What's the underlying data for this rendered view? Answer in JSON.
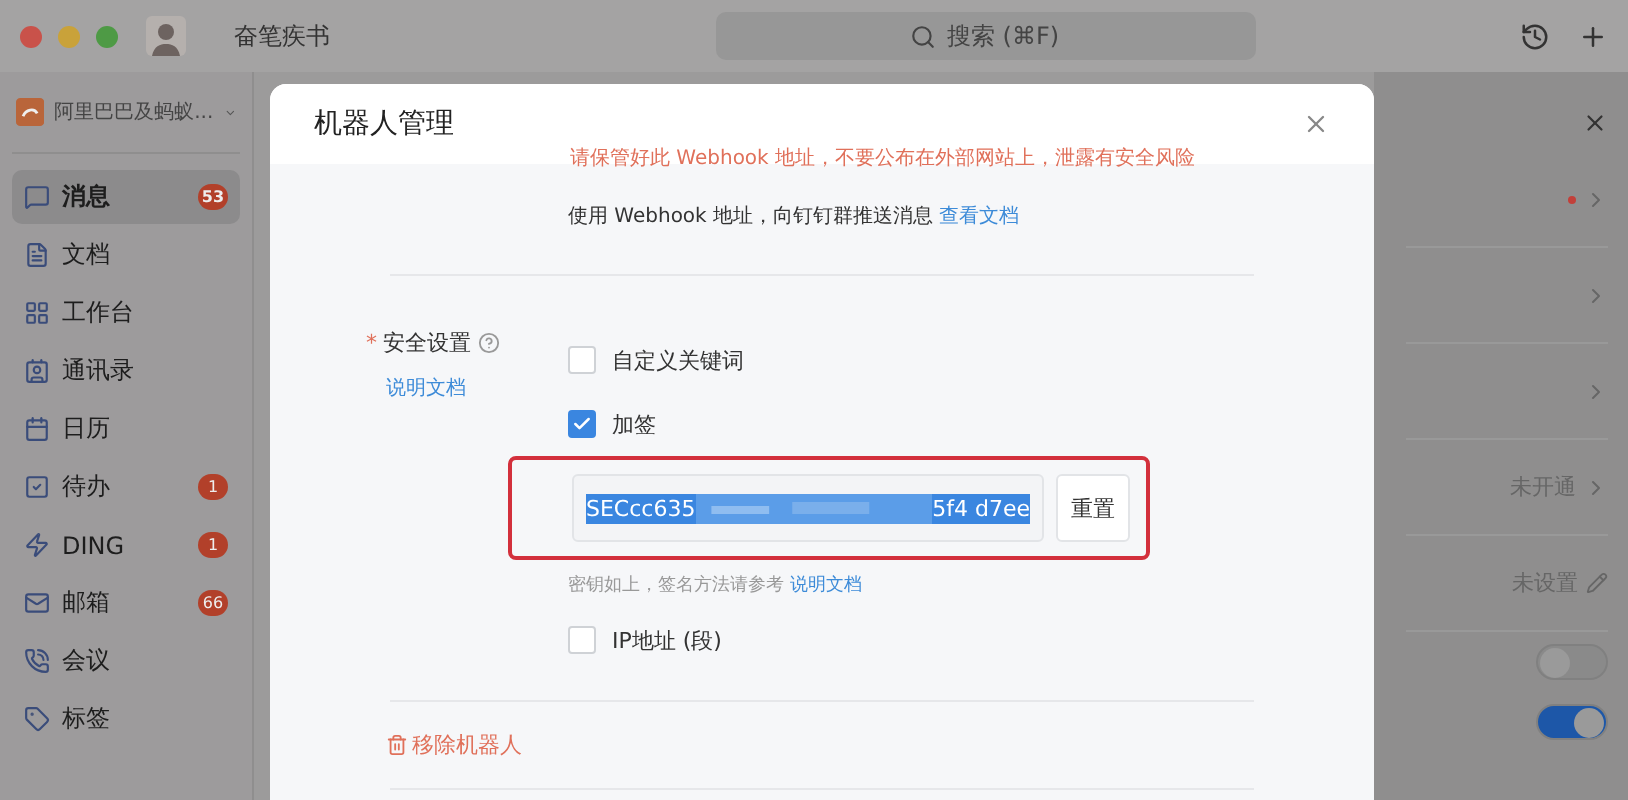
{
  "titlebar": {
    "user_name": "奋笔疾书",
    "search": {
      "placeholder": "搜索 (⌘F)"
    }
  },
  "sidebar": {
    "org": "阿里巴巴及蚂蚁...",
    "items": [
      {
        "label": "消息",
        "badge": "53",
        "selected": true
      },
      {
        "label": "文档",
        "selected": false
      },
      {
        "label": "工作台",
        "selected": false
      },
      {
        "label": "通讯录",
        "selected": false
      },
      {
        "label": "日历",
        "selected": false
      },
      {
        "label": "待办",
        "badge": "1",
        "selected": false
      },
      {
        "label": "DING",
        "badge": "1",
        "selected": false
      },
      {
        "label": "邮箱",
        "badge": "66",
        "selected": false
      },
      {
        "label": "会议",
        "selected": false
      },
      {
        "label": "标签",
        "selected": false
      }
    ]
  },
  "dialog": {
    "title": "机器人管理",
    "warning": "请保管好此 Webhook 地址，不要公布在外部网站上，泄露有安全风险",
    "webhook_note": "使用 Webhook 地址，向钉钉群推送消息",
    "webhook_link": "查看文档",
    "security": {
      "label": "安全设置",
      "required_mark": "*",
      "doc_link": "说明文档",
      "options": [
        {
          "kind": "checkbox",
          "label": "自定义关键词",
          "checked": false
        },
        {
          "kind": "checkbox",
          "label": "加签",
          "checked": true
        },
        {
          "kind": "secret",
          "value_start": "SECcc635",
          "value_end": "5f4 d7ee",
          "button": "重置",
          "highlighted": true
        },
        {
          "kind": "hint",
          "text": "密钥如上，签名方法请参考",
          "link": "说明文档"
        },
        {
          "kind": "checkbox",
          "label": "IP地址 (段)",
          "checked": false
        }
      ]
    },
    "remove": "移除机器人"
  },
  "right_panel": {
    "rows": [
      {
        "kind": "link",
        "dot": true
      },
      {
        "kind": "link",
        "dot": false
      },
      {
        "kind": "link",
        "dot": false
      },
      {
        "kind": "link",
        "value": "未开通"
      },
      {
        "kind": "edit",
        "value": "未设置"
      },
      {
        "kind": "toggle",
        "on": false
      },
      {
        "kind": "toggle",
        "on": true
      }
    ]
  }
}
